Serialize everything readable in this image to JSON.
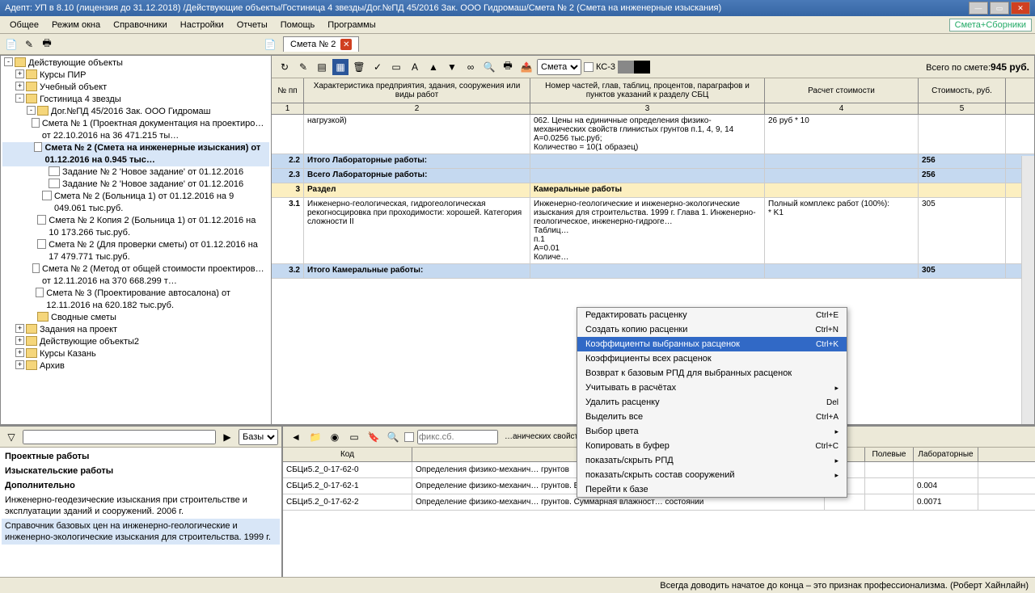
{
  "titlebar": "Адепт: УП в 8.10 (лицензия до 31.12.2018) /Действующие объекты/Гостиница 4 звезды/Дог.№ПД 45/2016 Зак. ООО Гидромаш/Смета № 2 (Смета на инженерные изыскания)",
  "menu": [
    "Общее",
    "Режим окна",
    "Справочники",
    "Настройки",
    "Отчеты",
    "Помощь",
    "Программы"
  ],
  "right_badge": "Смета+Сборники",
  "doc_tab": "Смета № 2",
  "tree": [
    {
      "indent": 0,
      "toggle": "-",
      "icon": "folder",
      "text": "Действующие объекты"
    },
    {
      "indent": 1,
      "toggle": "+",
      "icon": "folder",
      "text": "Курсы ПИР"
    },
    {
      "indent": 1,
      "toggle": "+",
      "icon": "folder",
      "text": "Учебный объект"
    },
    {
      "indent": 1,
      "toggle": "-",
      "icon": "folder",
      "text": "Гостиница 4 звезды"
    },
    {
      "indent": 2,
      "toggle": "-",
      "icon": "folder",
      "text": "Дог.№ПД 45/2016 Зак. ООО Гидромаш"
    },
    {
      "indent": 3,
      "icon": "doc",
      "text": "Смета № 1 (Проектная документация на проектиро…   от 22.10.2016 на 36 471.215 ты…"
    },
    {
      "indent": 3,
      "icon": "doc",
      "text": "Смета № 2 (Смета на инженерные изыскания)   от 01.12.2016 на 0.945 тыс…",
      "selected": true,
      "bold": true
    },
    {
      "indent": 3,
      "icon": "doc",
      "text": "Задание № 2 'Новое задание' от 01.12.2016"
    },
    {
      "indent": 3,
      "icon": "doc",
      "text": "Задание № 2 'Новое задание' от 01.12.2016"
    },
    {
      "indent": 3,
      "icon": "doc",
      "text": "Смета № 2 (Больница 1)  от 01.12.2016 на 9 049.061 тыс.руб."
    },
    {
      "indent": 3,
      "icon": "doc",
      "text": "Смета № 2 Копия 2 (Больница 1)  от 01.12.2016 на 10 173.266 тыс.руб."
    },
    {
      "indent": 3,
      "icon": "doc",
      "text": "Смета № 2 (Для проверки сметы)  от 01.12.2016 на 17 479.771 тыс.руб."
    },
    {
      "indent": 3,
      "icon": "doc",
      "text": "Смета № 2 (Метод от общей стоимости проектиров…   от 12.11.2016 на 370 668.299 т…"
    },
    {
      "indent": 3,
      "icon": "doc",
      "text": "Смета № 3 (Проектирование автосалона)  от 12.11.2016 на 620.182 тыс.руб."
    },
    {
      "indent": 2,
      "icon": "folder",
      "text": "Сводные сметы"
    },
    {
      "indent": 1,
      "toggle": "+",
      "icon": "folder",
      "text": "Задания на проект"
    },
    {
      "indent": 1,
      "toggle": "+",
      "icon": "folder",
      "text": "Действующие объекты2"
    },
    {
      "indent": 1,
      "toggle": "+",
      "icon": "folder",
      "text": "Курсы Казань"
    },
    {
      "indent": 1,
      "toggle": "+",
      "icon": "folder",
      "text": "Архив"
    }
  ],
  "right_tb": {
    "select": "Смета",
    "ks3": "КС-3",
    "total_label": "Всего по смете:",
    "total_value": "945 руб."
  },
  "grid_head": [
    "№ пп",
    "Характеристика предприятия, здания, сооружения или виды работ",
    "Номер частей, глав, таблиц, процентов, параграфов и пунктов указаний к разделу СБЦ",
    "Расчет стоимости",
    "Стоимость, руб."
  ],
  "grid_nums": [
    "1",
    "2",
    "3",
    "4",
    "5"
  ],
  "rows": [
    {
      "cls": "",
      "c1": "",
      "c2": "нагрузкой)",
      "c3": "062. Цены на единичные определения физико-механических свойств глинистых грунтов п.1, 4, 9, 14\nА=0.0256 тыс.руб;\nКоличество = 10(1 образец)",
      "c4": "26 руб * 10",
      "c5": ""
    },
    {
      "cls": "blue",
      "c1": "2.2",
      "c2": "Итого Лабораторные работы:",
      "c3": "",
      "c4": "",
      "c5": "256"
    },
    {
      "cls": "blue",
      "c1": "2.3",
      "c2": "Всего Лабораторные работы:",
      "c3": "",
      "c4": "",
      "c5": "256"
    },
    {
      "cls": "yellow",
      "c1": "3",
      "c2": "Раздел",
      "c3": "Камеральные работы",
      "c4": "",
      "c5": ""
    },
    {
      "cls": "",
      "c1": "3.1",
      "c2": "Инженерно-геологическая, гидрогеологическая рекогносцировка при проходимости: хорошей. Категория сложности II",
      "c3": "Инженерно-геологические и инженерно-экологические изыскания для строительства. 1999 г. Глава 1. Инженерно-геологическое, инженерно-гидроге…\nТаблиц…\nп.1\nА=0.01\nКоличе…",
      "c4": "Полный комплекс работ (100%):\n             * K1",
      "c5": "305"
    },
    {
      "cls": "blue",
      "c1": "3.2",
      "c2": "Итого Камеральные работы:",
      "c3": "",
      "c4": "",
      "c5": "305"
    }
  ],
  "context_menu": [
    {
      "label": "Редактировать расценку",
      "sc": "Ctrl+E"
    },
    {
      "label": "Создать копию расценки",
      "sc": "Ctrl+N"
    },
    {
      "label": "Коэффициенты выбранных расценок",
      "sc": "Ctrl+K",
      "hl": true
    },
    {
      "label": "Коэффициенты всех расценок"
    },
    {
      "label": "Возврат к базовым РПД для выбранных расценок"
    },
    {
      "label": "Учитывать в расчётах",
      "sub": "▸"
    },
    {
      "label": "Удалить расценку",
      "sc": "Del"
    },
    {
      "label": "Выделить все",
      "sc": "Ctrl+A"
    },
    {
      "label": "Выбор цвета",
      "sub": "▸"
    },
    {
      "label": "Копировать в буфер",
      "sc": "Ctrl+C"
    },
    {
      "label": "показать/скрыть РПД",
      "sub": "▸"
    },
    {
      "label": "показать/скрыть состав сооружений",
      "sub": "▸"
    },
    {
      "label": "Перейти к базе"
    }
  ],
  "bl_select": "Базы",
  "bl_items": [
    {
      "text": "Проектные работы",
      "bold": true
    },
    {
      "text": "Изыскательские работы",
      "bold": true
    },
    {
      "text": "Дополнительно",
      "bold": true
    },
    {
      "text": "Инженерно-геодезические изыскания при строительстве и эксплуатации зданий и сооружений. 2006 г."
    },
    {
      "text": "Справочник базовых цен на инженерно-геологические и инженерно-экологические изыскания для строительства. 1999 г.",
      "sel": true
    }
  ],
  "br_crumb": "…анических свойств глинистых грунтов.",
  "br_placeholder": "фикс.сб.",
  "br_head": [
    "Код",
    "Наименов…",
    "…",
    "А",
    "Полевые",
    "Лабораторные"
  ],
  "br_rows": [
    {
      "b1": "СБЦи5.2_0-17-62-0",
      "b2": "Определения физико-механич… грунтов",
      "b5": ""
    },
    {
      "b1": "СБЦи5.2_0-17-62-1",
      "b2": "Определение физико-механич… грунтов. Влажность",
      "b5": "0.004"
    },
    {
      "b1": "СБЦи5.2_0-17-62-2",
      "b2": "Определение физико-механич… грунтов. Суммарная влажност… состоянии",
      "b5": "0.0071"
    }
  ],
  "status": "Всегда доводить начатое до конца – это признак профессионализма. (Роберт Хайнлайн)"
}
